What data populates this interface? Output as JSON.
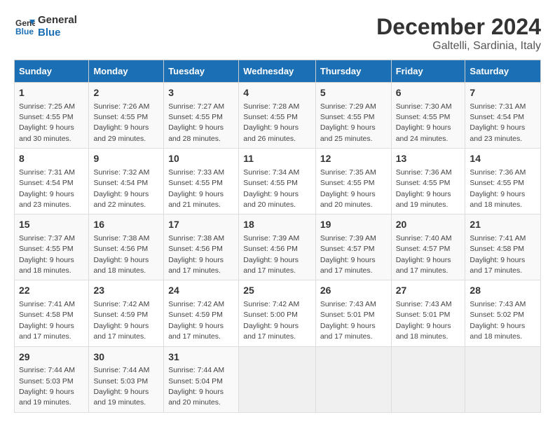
{
  "logo": {
    "line1": "General",
    "line2": "Blue"
  },
  "title": "December 2024",
  "subtitle": "Galtelli, Sardinia, Italy",
  "days_of_week": [
    "Sunday",
    "Monday",
    "Tuesday",
    "Wednesday",
    "Thursday",
    "Friday",
    "Saturday"
  ],
  "weeks": [
    [
      {
        "num": "1",
        "sunrise": "7:25 AM",
        "sunset": "4:55 PM",
        "daylight": "9 hours and 30 minutes."
      },
      {
        "num": "2",
        "sunrise": "7:26 AM",
        "sunset": "4:55 PM",
        "daylight": "9 hours and 29 minutes."
      },
      {
        "num": "3",
        "sunrise": "7:27 AM",
        "sunset": "4:55 PM",
        "daylight": "9 hours and 28 minutes."
      },
      {
        "num": "4",
        "sunrise": "7:28 AM",
        "sunset": "4:55 PM",
        "daylight": "9 hours and 26 minutes."
      },
      {
        "num": "5",
        "sunrise": "7:29 AM",
        "sunset": "4:55 PM",
        "daylight": "9 hours and 25 minutes."
      },
      {
        "num": "6",
        "sunrise": "7:30 AM",
        "sunset": "4:55 PM",
        "daylight": "9 hours and 24 minutes."
      },
      {
        "num": "7",
        "sunrise": "7:31 AM",
        "sunset": "4:54 PM",
        "daylight": "9 hours and 23 minutes."
      }
    ],
    [
      {
        "num": "8",
        "sunrise": "7:31 AM",
        "sunset": "4:54 PM",
        "daylight": "9 hours and 23 minutes."
      },
      {
        "num": "9",
        "sunrise": "7:32 AM",
        "sunset": "4:54 PM",
        "daylight": "9 hours and 22 minutes."
      },
      {
        "num": "10",
        "sunrise": "7:33 AM",
        "sunset": "4:55 PM",
        "daylight": "9 hours and 21 minutes."
      },
      {
        "num": "11",
        "sunrise": "7:34 AM",
        "sunset": "4:55 PM",
        "daylight": "9 hours and 20 minutes."
      },
      {
        "num": "12",
        "sunrise": "7:35 AM",
        "sunset": "4:55 PM",
        "daylight": "9 hours and 20 minutes."
      },
      {
        "num": "13",
        "sunrise": "7:36 AM",
        "sunset": "4:55 PM",
        "daylight": "9 hours and 19 minutes."
      },
      {
        "num": "14",
        "sunrise": "7:36 AM",
        "sunset": "4:55 PM",
        "daylight": "9 hours and 18 minutes."
      }
    ],
    [
      {
        "num": "15",
        "sunrise": "7:37 AM",
        "sunset": "4:55 PM",
        "daylight": "9 hours and 18 minutes."
      },
      {
        "num": "16",
        "sunrise": "7:38 AM",
        "sunset": "4:56 PM",
        "daylight": "9 hours and 18 minutes."
      },
      {
        "num": "17",
        "sunrise": "7:38 AM",
        "sunset": "4:56 PM",
        "daylight": "9 hours and 17 minutes."
      },
      {
        "num": "18",
        "sunrise": "7:39 AM",
        "sunset": "4:56 PM",
        "daylight": "9 hours and 17 minutes."
      },
      {
        "num": "19",
        "sunrise": "7:39 AM",
        "sunset": "4:57 PM",
        "daylight": "9 hours and 17 minutes."
      },
      {
        "num": "20",
        "sunrise": "7:40 AM",
        "sunset": "4:57 PM",
        "daylight": "9 hours and 17 minutes."
      },
      {
        "num": "21",
        "sunrise": "7:41 AM",
        "sunset": "4:58 PM",
        "daylight": "9 hours and 17 minutes."
      }
    ],
    [
      {
        "num": "22",
        "sunrise": "7:41 AM",
        "sunset": "4:58 PM",
        "daylight": "9 hours and 17 minutes."
      },
      {
        "num": "23",
        "sunrise": "7:42 AM",
        "sunset": "4:59 PM",
        "daylight": "9 hours and 17 minutes."
      },
      {
        "num": "24",
        "sunrise": "7:42 AM",
        "sunset": "4:59 PM",
        "daylight": "9 hours and 17 minutes."
      },
      {
        "num": "25",
        "sunrise": "7:42 AM",
        "sunset": "5:00 PM",
        "daylight": "9 hours and 17 minutes."
      },
      {
        "num": "26",
        "sunrise": "7:43 AM",
        "sunset": "5:01 PM",
        "daylight": "9 hours and 17 minutes."
      },
      {
        "num": "27",
        "sunrise": "7:43 AM",
        "sunset": "5:01 PM",
        "daylight": "9 hours and 18 minutes."
      },
      {
        "num": "28",
        "sunrise": "7:43 AM",
        "sunset": "5:02 PM",
        "daylight": "9 hours and 18 minutes."
      }
    ],
    [
      {
        "num": "29",
        "sunrise": "7:44 AM",
        "sunset": "5:03 PM",
        "daylight": "9 hours and 19 minutes."
      },
      {
        "num": "30",
        "sunrise": "7:44 AM",
        "sunset": "5:03 PM",
        "daylight": "9 hours and 19 minutes."
      },
      {
        "num": "31",
        "sunrise": "7:44 AM",
        "sunset": "5:04 PM",
        "daylight": "9 hours and 20 minutes."
      },
      null,
      null,
      null,
      null
    ]
  ],
  "labels": {
    "sunrise": "Sunrise:",
    "sunset": "Sunset:",
    "daylight": "Daylight:"
  }
}
